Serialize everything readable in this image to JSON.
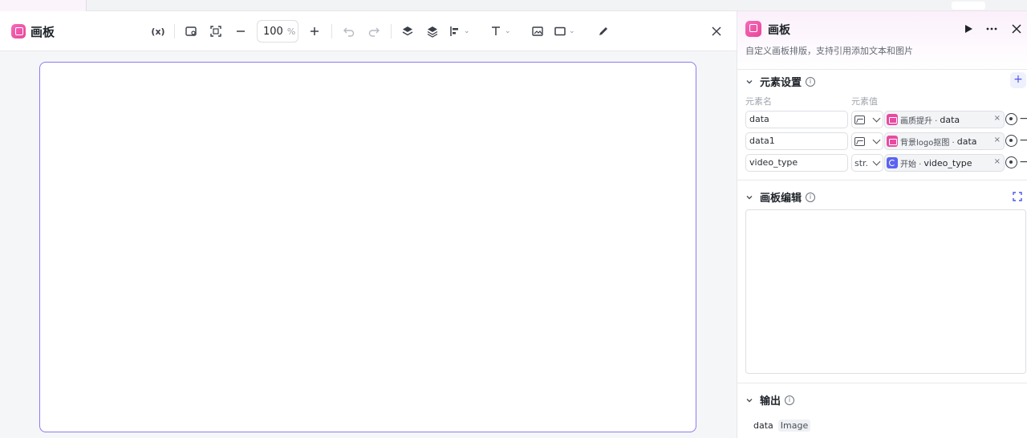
{
  "editor": {
    "title": "画板",
    "zoom": {
      "value": "100",
      "unit": "%"
    },
    "toolbar": {
      "variable_label": "(x)",
      "icons": [
        "variable-icon",
        "canvas-settings-icon",
        "fit-screen-icon",
        "zoom-out-icon",
        "zoom-in-icon",
        "undo-icon",
        "redo-icon",
        "bring-forward-icon",
        "layers-icon",
        "align-icon",
        "text-icon",
        "image-icon",
        "shape-icon",
        "pen-icon",
        "close-icon"
      ]
    }
  },
  "panel": {
    "title": "画板",
    "description": "自定义画板排版，支持引用添加文本和图片",
    "element_settings": {
      "title": "元素设置",
      "info": "i",
      "add_label": "+",
      "columns": {
        "name": "元素名",
        "value": "元素值"
      },
      "rows": [
        {
          "name": "data",
          "type": "image",
          "type_label": "",
          "node": "画质提升 · ",
          "variable": "data",
          "remove": "×",
          "delete": "−"
        },
        {
          "name": "data1",
          "type": "image",
          "type_label": "",
          "node": "背景logo抠图 · ",
          "variable": "data",
          "remove": "×",
          "delete": "−"
        },
        {
          "name": "video_type",
          "type": "string",
          "type_label": "str.",
          "node": "开始 · ",
          "variable": "video_type",
          "remove": "×",
          "delete": "−"
        }
      ]
    },
    "canvas_edit": {
      "title": "画板编辑",
      "info": "i"
    },
    "output": {
      "title": "输出",
      "info": "i",
      "items": [
        {
          "name": "data",
          "type": "Image"
        }
      ]
    }
  },
  "colors": {
    "accent": "#4d53e8",
    "brand_pink": "#e94aa0",
    "canvas_border": "#8b7bf0"
  }
}
